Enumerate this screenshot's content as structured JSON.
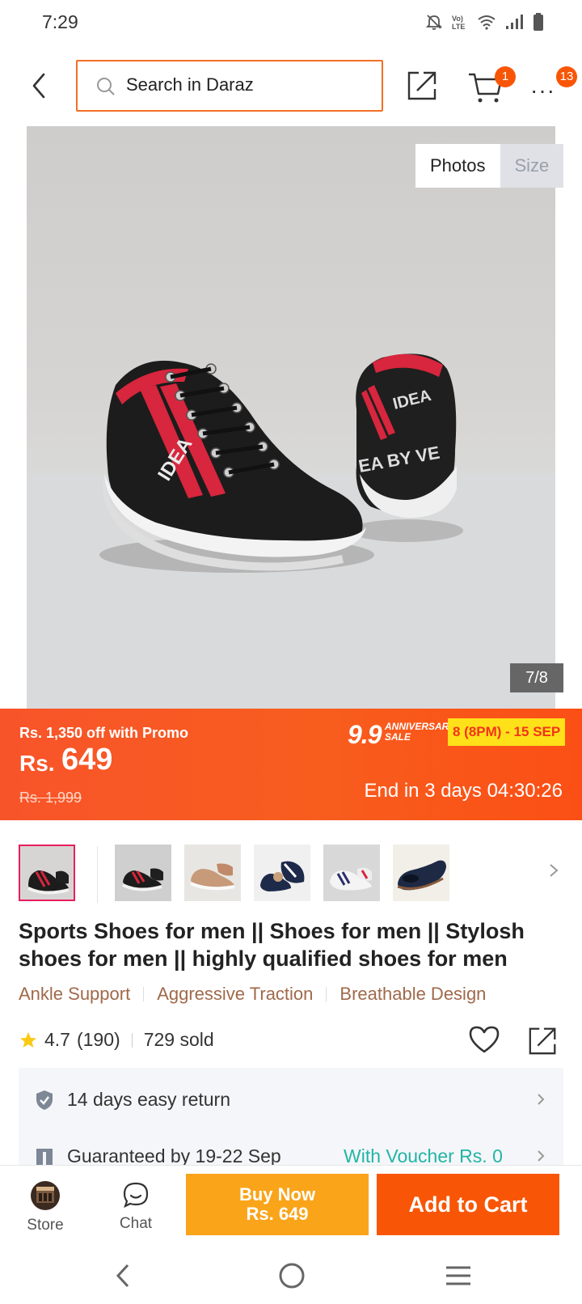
{
  "status_bar": {
    "time": "7:29"
  },
  "header": {
    "search_placeholder": "Search in Daraz",
    "cart_count": "1",
    "more_count": "13"
  },
  "gallery": {
    "tabs": [
      "Photos",
      "Size"
    ],
    "active_tab": "Photos",
    "counter": "7/8",
    "photo_text": [
      "IDEA",
      "EA BY VE"
    ]
  },
  "promo": {
    "promo_text": "Rs. 1,350 off with Promo",
    "currency": "Rs.",
    "price": "649",
    "original_price": "Rs. 1,999",
    "sale_number": "9.9",
    "sale_word": "ANNIVERSARY SALE",
    "sale_dates": "8 (8PM) - 15 SEP",
    "countdown": "End in 3 days 04:30:26",
    "colors": {
      "banner": "#f8542a",
      "date_bg": "#ffe11a",
      "date_text": "#f4331a"
    }
  },
  "thumbnails": {
    "count": 6,
    "selected_index": 0
  },
  "product": {
    "title": "Sports Shoes for men || Shoes for men || Stylosh shoes for men || highly qualified shoes for men",
    "tags": [
      "Ankle Support",
      "Aggressive Traction",
      "Breathable Design"
    ],
    "rating": "4.7",
    "reviews": "(190)",
    "sold": "729 sold"
  },
  "service": {
    "return_label": "14 days easy return",
    "delivery_label": "Guaranteed by 19-22 Sep",
    "voucher_label": "With Voucher Rs. 0"
  },
  "action_bar": {
    "store_label": "Store",
    "chat_label": "Chat",
    "buy_now_line1": "Buy Now",
    "buy_now_line2": "Rs. 649",
    "add_to_cart": "Add to Cart",
    "colors": {
      "buy_now": "#faa41a",
      "add_to_cart": "#f85606"
    }
  },
  "icons": {
    "status": [
      "mute-icon",
      "volte-icon",
      "wifi-icon",
      "signal-icon",
      "battery-icon"
    ],
    "nav": [
      "back-nav-icon",
      "home-nav-icon",
      "menu-nav-icon"
    ]
  }
}
